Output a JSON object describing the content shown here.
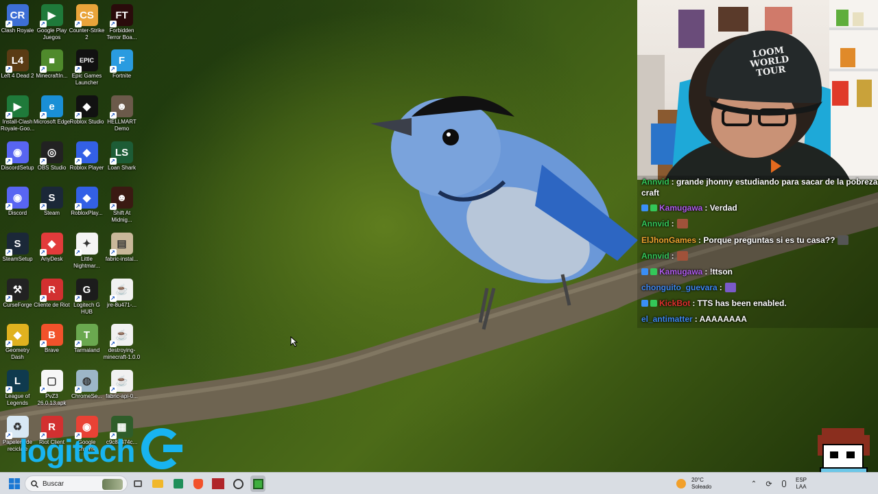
{
  "desktop": {
    "icons": [
      {
        "label": "Clash Royale",
        "glyph": "CR",
        "color": "#3d6fd6"
      },
      {
        "label": "Google Play Juegos",
        "glyph": "▶",
        "color": "#1f7a3a"
      },
      {
        "label": "Counter-Strike 2",
        "glyph": "CS",
        "color": "#e9a43a"
      },
      {
        "label": "Forbidden Terror Boa...",
        "glyph": "FT",
        "color": "#2a0b0b"
      },
      {
        "label": "Left 4 Dead 2",
        "glyph": "L4",
        "color": "#5a3b14"
      },
      {
        "label": "MinecraftIn...",
        "glyph": "■",
        "color": "#4f8a2c"
      },
      {
        "label": "Epic Games Launcher",
        "glyph": "EPIC",
        "color": "#111111"
      },
      {
        "label": "Fortnite",
        "glyph": "F",
        "color": "#2a9be0"
      },
      {
        "label": "Install-Clash Royale-Goo...",
        "glyph": "▶",
        "color": "#1f7a3a"
      },
      {
        "label": "Microsoft Edge",
        "glyph": "e",
        "color": "#1a8fd6"
      },
      {
        "label": "Roblox Studio",
        "glyph": "◆",
        "color": "#111111"
      },
      {
        "label": "HELLMART Demo",
        "glyph": "☻",
        "color": "#6b5a4a"
      },
      {
        "label": "DiscordSetup",
        "glyph": "◉",
        "color": "#5865f2"
      },
      {
        "label": "OBS Studio",
        "glyph": "◎",
        "color": "#222222"
      },
      {
        "label": "Roblox Player",
        "glyph": "◆",
        "color": "#3360e6"
      },
      {
        "label": "Loan Shark",
        "glyph": "LS",
        "color": "#1d5c36"
      },
      {
        "label": "Discord",
        "glyph": "◉",
        "color": "#5865f2"
      },
      {
        "label": "Steam",
        "glyph": "S",
        "color": "#1b2838"
      },
      {
        "label": "RobloxPlay...",
        "glyph": "◆",
        "color": "#3360e6"
      },
      {
        "label": "Shift At Midnig...",
        "glyph": "☻",
        "color": "#3a1a12"
      },
      {
        "label": "SteamSetup",
        "glyph": "S",
        "color": "#1b2838"
      },
      {
        "label": "AnyDesk",
        "glyph": "◆",
        "color": "#e23b3b"
      },
      {
        "label": "Little Nightmar...",
        "glyph": "✦",
        "color": "#f4f4f4"
      },
      {
        "label": "fabric-instal...",
        "glyph": "▤",
        "color": "#c9b89a"
      },
      {
        "label": "CurseForge",
        "glyph": "⚒",
        "color": "#222222"
      },
      {
        "label": "Cliente de Riot",
        "glyph": "R",
        "color": "#d23030"
      },
      {
        "label": "Logitech G HUB",
        "glyph": "G",
        "color": "#1c1c1c"
      },
      {
        "label": "jre-8u471-...",
        "glyph": "☕",
        "color": "#f1f1f1"
      },
      {
        "label": "Geometry Dash",
        "glyph": "◆",
        "color": "#e0b21f"
      },
      {
        "label": "Brave",
        "glyph": "B",
        "color": "#f2522b"
      },
      {
        "label": "Tarmaland",
        "glyph": "T",
        "color": "#6aa84f"
      },
      {
        "label": "destroying-minecraft-1.0.0",
        "glyph": "☕",
        "color": "#f1f1f1"
      },
      {
        "label": "League of Legends",
        "glyph": "L",
        "color": "#0f3a4e"
      },
      {
        "label": "PvZ3 26.0.13.apk",
        "glyph": "▢",
        "color": "#f6f6f6"
      },
      {
        "label": "ChromeSe...",
        "glyph": "◍",
        "color": "#9db6c8"
      },
      {
        "label": "fabric-api-0...",
        "glyph": "☕",
        "color": "#f1f1f1"
      },
      {
        "label": "Papelera de reciclaje",
        "glyph": "♻",
        "color": "#d8e8f4"
      },
      {
        "label": "Riot Client",
        "glyph": "R",
        "color": "#d23030"
      },
      {
        "label": "Google Chrome",
        "glyph": "◉",
        "color": "#e94235"
      },
      {
        "label": "c9c8a474c...",
        "glyph": "▦",
        "color": "#2f5d2a"
      }
    ]
  },
  "overlay": {
    "logitech_text": "logitech",
    "brand_color": "#18b4f0"
  },
  "chat": {
    "messages": [
      {
        "user": "Annvid",
        "user_color": "#34c759",
        "text": ": grande jhonny estudiando para sacar de la pobreza de",
        "badge_color": ""
      },
      {
        "user": "",
        "user_color": "#ffffff",
        "text": "craft",
        "badge_color": ""
      },
      {
        "user": "Kamugawa",
        "user_color": "#b15cf0",
        "text": ": Verdad",
        "badge_color": "#3a8ef6"
      },
      {
        "user": "Annvid",
        "user_color": "#34c759",
        "text": ":",
        "badge_color": "",
        "emote": "#a0523a"
      },
      {
        "user": "ElJhonGames",
        "user_color": "#f0a530",
        "text": ": Porque preguntas si es tu casa??",
        "badge_color": "",
        "emote": "#555555"
      },
      {
        "user": "Annvid",
        "user_color": "#34c759",
        "text": ":",
        "badge_color": "",
        "emote": "#a0523a"
      },
      {
        "user": "Kamugawa",
        "user_color": "#b15cf0",
        "text": ": !ttson",
        "badge_color": "#3a8ef6"
      },
      {
        "user": "chonguito_guevara",
        "user_color": "#3c86f0",
        "text": ":",
        "badge_color": "",
        "emote": "#7a5ac9"
      },
      {
        "user": "KickBot",
        "user_color": "#e0302e",
        "text": ": TTS has been enabled.",
        "badge_color": "#3a8ef6"
      },
      {
        "user": "el_antimatter",
        "user_color": "#3c86f0",
        "text": ": AAAAAAAA",
        "badge_color": ""
      }
    ]
  },
  "webcam": {
    "cap_text_line1": "LOOM",
    "cap_text_line2": "WORLD",
    "cap_text_line3": "TOUR"
  },
  "taskbar": {
    "search_placeholder": "Buscar",
    "weather_temp": "20°C",
    "weather_desc": "Soleado",
    "lang_line1": "ESP",
    "lang_line2": "LAA",
    "apps": [
      "task-view-icon",
      "file-explorer-icon",
      "store-icon",
      "brave-icon",
      "game-app-icon",
      "obs-icon",
      "minecraft-icon"
    ]
  }
}
